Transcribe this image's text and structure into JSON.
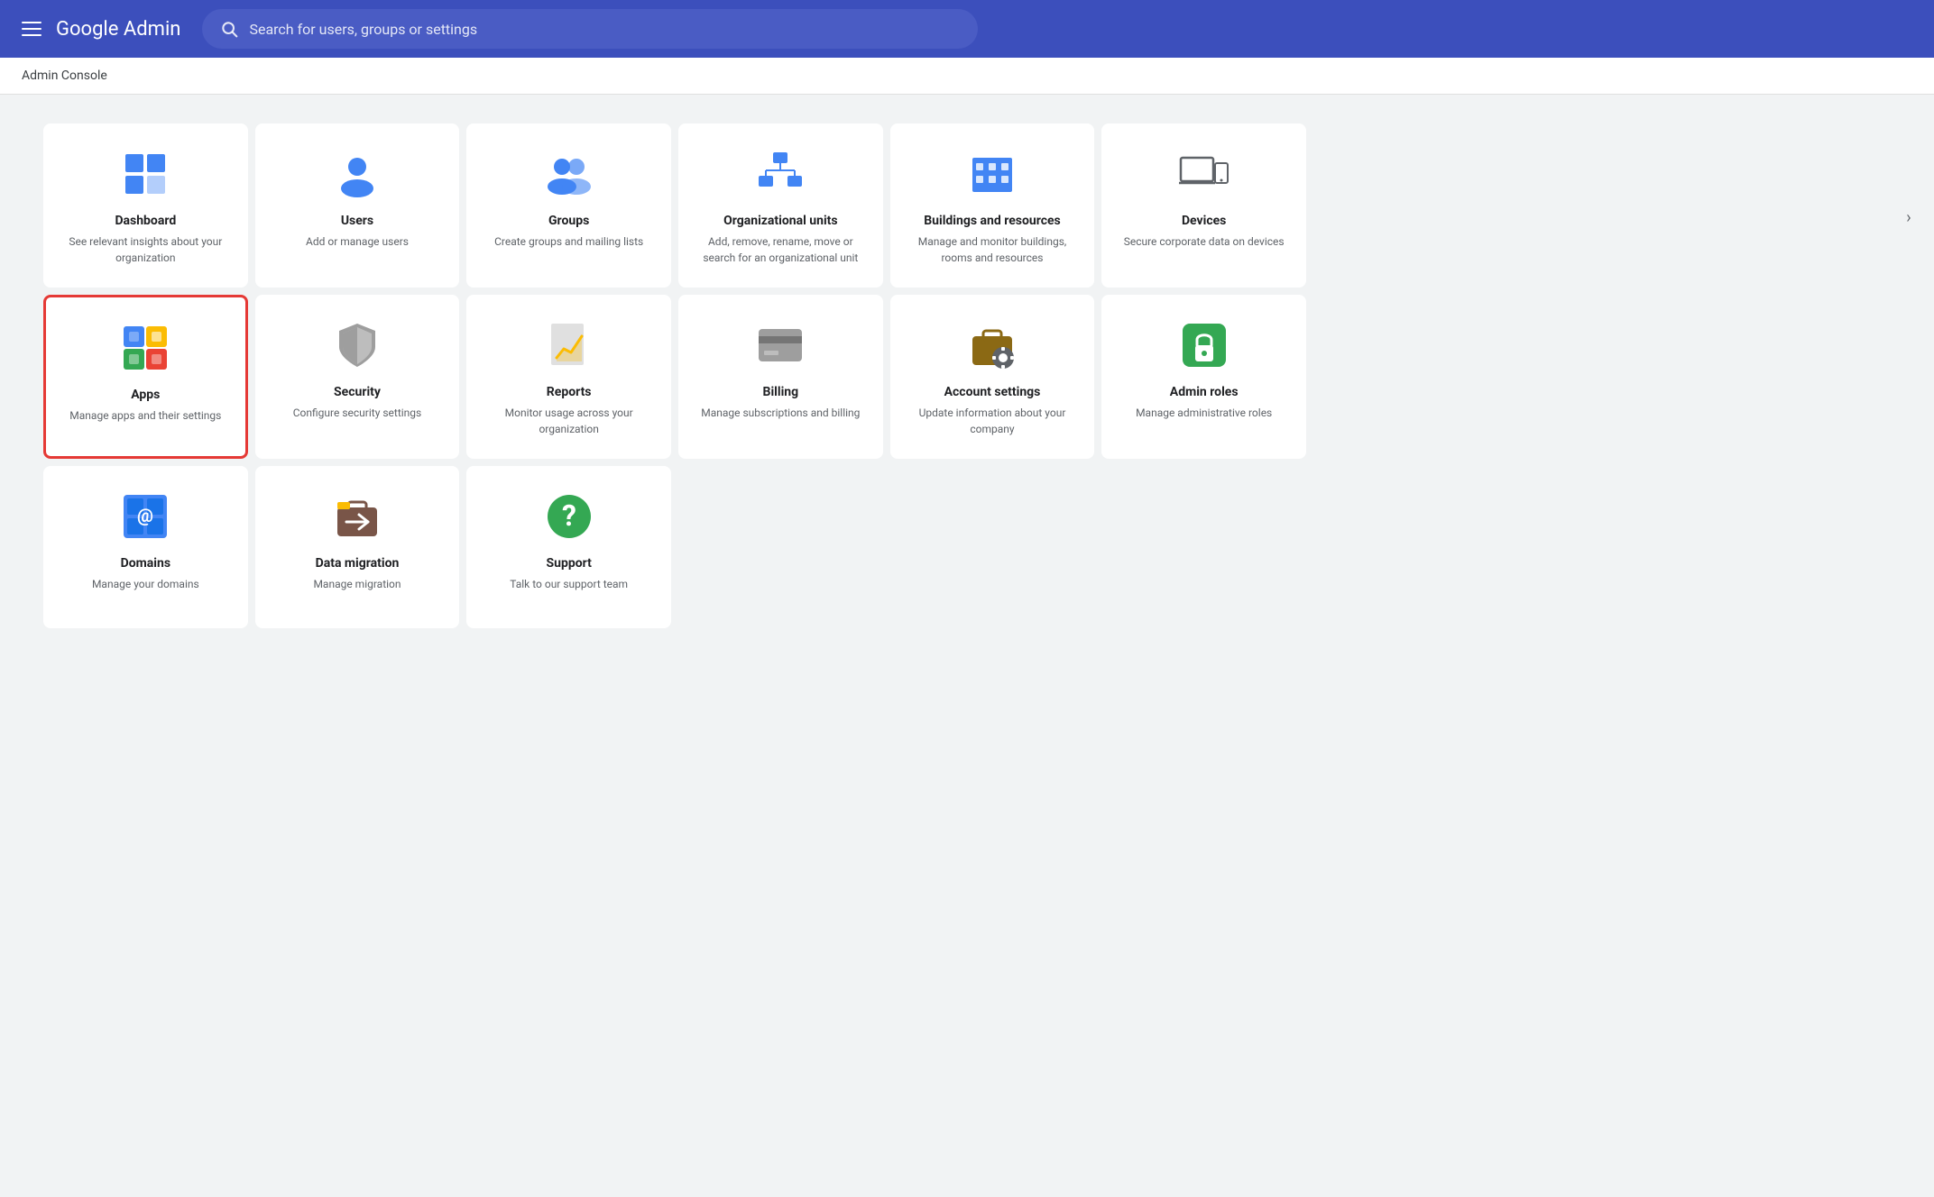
{
  "header": {
    "menu_label": "Menu",
    "logo_text": "Google Admin",
    "search_placeholder": "Search for users, groups or settings"
  },
  "sub_header": {
    "title": "Admin Console"
  },
  "chevron": "›",
  "cards": {
    "row1": [
      {
        "id": "dashboard",
        "title": "Dashboard",
        "desc": "See relevant insights about your organization",
        "highlighted": false
      },
      {
        "id": "users",
        "title": "Users",
        "desc": "Add or manage users",
        "highlighted": false
      },
      {
        "id": "groups",
        "title": "Groups",
        "desc": "Create groups and mailing lists",
        "highlighted": false
      },
      {
        "id": "org-units",
        "title": "Organizational units",
        "desc": "Add, remove, rename, move or search for an organizational unit",
        "highlighted": false
      },
      {
        "id": "buildings",
        "title": "Buildings and resources",
        "desc": "Manage and monitor buildings, rooms and resources",
        "highlighted": false
      },
      {
        "id": "devices",
        "title": "Devices",
        "desc": "Secure corporate data on devices",
        "highlighted": false
      }
    ],
    "row2": [
      {
        "id": "apps",
        "title": "Apps",
        "desc": "Manage apps and their settings",
        "highlighted": true
      },
      {
        "id": "security",
        "title": "Security",
        "desc": "Configure security settings",
        "highlighted": false
      },
      {
        "id": "reports",
        "title": "Reports",
        "desc": "Monitor usage across your organization",
        "highlighted": false
      },
      {
        "id": "billing",
        "title": "Billing",
        "desc": "Manage subscriptions and billing",
        "highlighted": false
      },
      {
        "id": "account-settings",
        "title": "Account settings",
        "desc": "Update information about your company",
        "highlighted": false
      },
      {
        "id": "admin-roles",
        "title": "Admin roles",
        "desc": "Manage administrative roles",
        "highlighted": false
      }
    ],
    "row3": [
      {
        "id": "domains",
        "title": "Domains",
        "desc": "Manage your domains",
        "highlighted": false
      },
      {
        "id": "data-migration",
        "title": "Data migration",
        "desc": "Manage migration",
        "highlighted": false
      },
      {
        "id": "support",
        "title": "Support",
        "desc": "Talk to our support team",
        "highlighted": false
      }
    ]
  }
}
